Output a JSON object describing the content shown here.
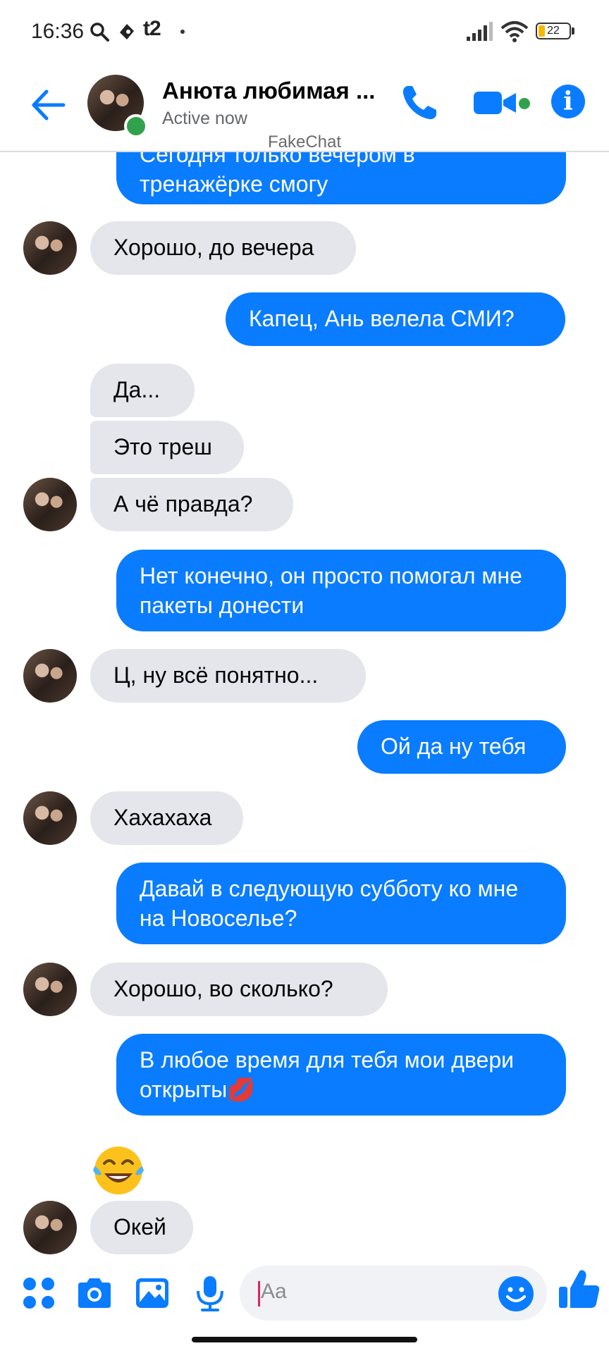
{
  "status_bar": {
    "time": "16:36",
    "carrier": "t2",
    "battery": "22",
    "battery_level_pct": 22
  },
  "header": {
    "contact_name": "Анюта любимая ...",
    "status": "Active now",
    "watermark": "FakeChat",
    "colors": {
      "accent": "#0a7cff",
      "online": "#31a24c"
    }
  },
  "messages": [
    {
      "from": "me",
      "text": "Сегодня только вечером в тренажёрке смогу"
    },
    {
      "from": "them",
      "text": "Хорошо, до вечера"
    },
    {
      "from": "me",
      "text": "Капец, Ань велела СМИ?"
    },
    {
      "from": "them",
      "text": "Да..."
    },
    {
      "from": "them",
      "text": "Это треш"
    },
    {
      "from": "them",
      "text": "А чё правда?"
    },
    {
      "from": "me",
      "text": "Нет конечно, он просто помогал мне пакеты донести"
    },
    {
      "from": "them",
      "text": "Ц, ну всё понятно..."
    },
    {
      "from": "me",
      "text": "Ой да ну тебя"
    },
    {
      "from": "them",
      "text": "Хахахаха"
    },
    {
      "from": "me",
      "text": "Давай в следующую субботу ко мне на Новоселье?"
    },
    {
      "from": "them",
      "text": "Хорошо, во сколько?"
    },
    {
      "from": "me",
      "text": "В любое время для тебя мои двери открыты💋"
    },
    {
      "from": "them",
      "emoji": "face-with-tears-of-joy"
    },
    {
      "from": "them",
      "text": "Окей"
    }
  ],
  "composer": {
    "placeholder": "Aa",
    "icons": [
      "apps-icon",
      "camera-icon",
      "gallery-icon",
      "mic-icon",
      "emoji-icon",
      "like-icon"
    ]
  }
}
